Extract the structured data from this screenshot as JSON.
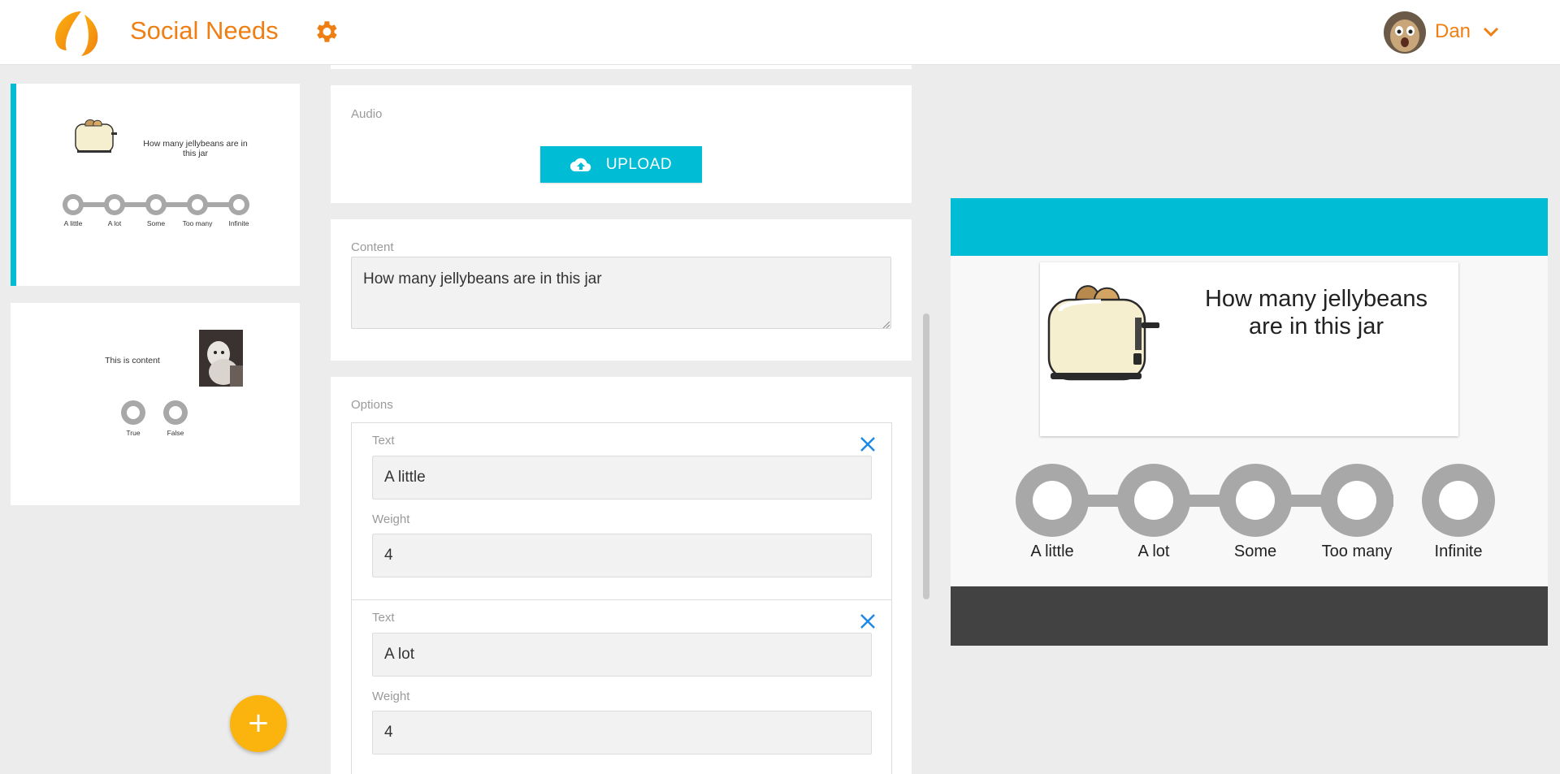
{
  "header": {
    "app_title": "Social Needs",
    "user_name": "Dan",
    "icons": [
      "logo-icon",
      "gear-icon",
      "avatar",
      "chevron-down-icon"
    ]
  },
  "slides": [
    {
      "question": "How many jellybeans are in this jar",
      "options": [
        "A little",
        "A lot",
        "Some",
        "Too many",
        "Infinite"
      ]
    },
    {
      "question": "This is content",
      "options": [
        "True",
        "False"
      ]
    }
  ],
  "add_button": "+",
  "editor": {
    "audio_label": "Audio",
    "upload_label": "UPLOAD",
    "content_label": "Content",
    "content_value": "How many jellybeans are in this jar",
    "options_label": "Options",
    "options": [
      {
        "text_label": "Text",
        "text": "A little",
        "weight_label": "Weight",
        "weight": "4"
      },
      {
        "text_label": "Text",
        "text": "A lot",
        "weight_label": "Weight",
        "weight": "4"
      }
    ]
  },
  "preview": {
    "question": "How many jellybeans are in this jar",
    "options": [
      "A little",
      "A lot",
      "Some",
      "Too many",
      "Infinite"
    ]
  },
  "colors": {
    "brand_orange": "#f07f13",
    "accent_cyan": "#00bcd4",
    "fab_yellow": "#fbb30e",
    "dark_footer": "#424242",
    "scale_grey": "#a8a8a8"
  }
}
